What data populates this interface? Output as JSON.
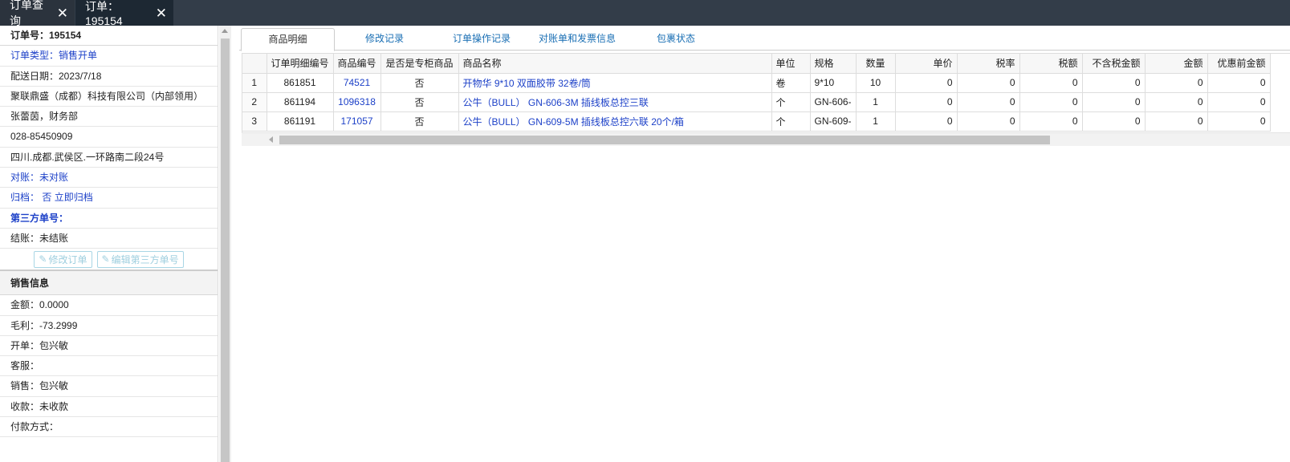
{
  "top_tabs": [
    {
      "label": "订单查询"
    },
    {
      "label": "订单：195154"
    }
  ],
  "order": {
    "order_no": "订单号：195154",
    "type": "订单类型：销售开单",
    "delivery_date": "配送日期：2023/7/18",
    "company": "聚联鼎盛（成都）科技有限公司（内部领用）",
    "contact": "张蕾茵，财务部",
    "phone": "028-85450909",
    "address": "四川.成都.武侯区.一环路南二段24号",
    "reconcile": "对账：未对账",
    "archive_label": "归档：",
    "archive_value": "否",
    "archive_action": "立即归档",
    "third_party": "第三方单号：",
    "settle": "结账：未结账",
    "btn_edit_order": "修改订单",
    "btn_edit_third": "编辑第三方单号"
  },
  "sales": {
    "title": "销售信息",
    "amount": "金额：0.0000",
    "profit": "毛利：-73.2999",
    "issuer": "开单：包兴敏",
    "service": "客服：",
    "seller": "销售：包兴敏",
    "receipt": "收款：未收款",
    "payment": "付款方式："
  },
  "detail_tabs": [
    {
      "label": "商品明细"
    },
    {
      "label": "修改记录"
    },
    {
      "label": "订单操作记录"
    },
    {
      "label": "对账单和发票信息"
    },
    {
      "label": "包裹状态"
    }
  ],
  "table": {
    "headers": [
      "",
      "订单明细编号",
      "商品编号",
      "是否是专柜商品",
      "商品名称",
      "单位",
      "规格",
      "数量",
      "单价",
      "税率",
      "税额",
      "不含税金额",
      "金额",
      "优惠前金额"
    ],
    "rows": [
      [
        "1",
        "861851",
        "74521",
        "否",
        "开物华 9*10 双面胶带 32卷/筒",
        "卷",
        "9*10",
        "10",
        "0",
        "0",
        "0",
        "0",
        "0",
        "0"
      ],
      [
        "2",
        "861194",
        "1096318",
        "否",
        "公牛（BULL） GN-606-3M 插线板总控三联",
        "个",
        "GN-606-",
        "1",
        "0",
        "0",
        "0",
        "0",
        "0",
        "0"
      ],
      [
        "3",
        "861191",
        "171057",
        "否",
        "公牛（BULL） GN-609-5M 插线板总控六联 20个/箱",
        "个",
        "GN-609-",
        "1",
        "0",
        "0",
        "0",
        "0",
        "0",
        "0"
      ]
    ]
  }
}
